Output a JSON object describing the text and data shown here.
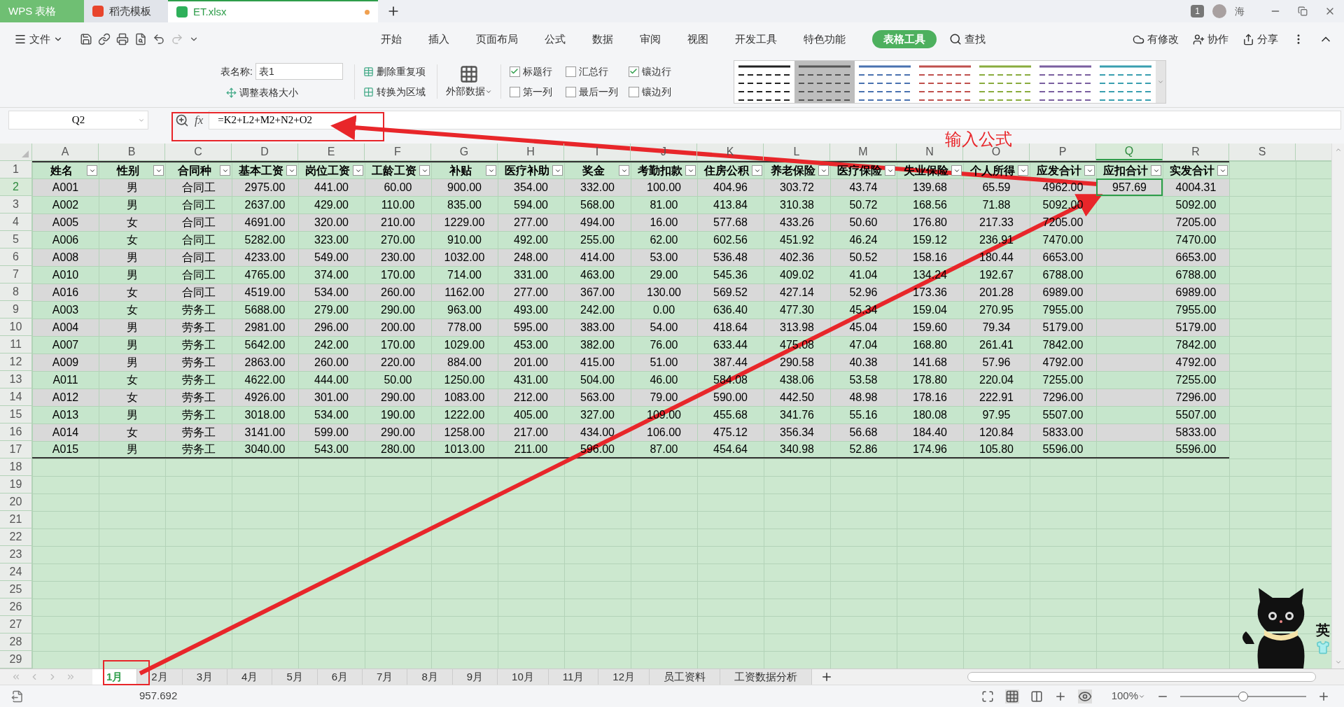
{
  "app_tabs": [
    {
      "label": "WPS 表格",
      "kind": "home",
      "selected": false
    },
    {
      "label": "稻壳模板",
      "kind": "template",
      "selected": false
    },
    {
      "label": "ET.xlsx",
      "kind": "sheet",
      "selected": true,
      "unsaved": true
    }
  ],
  "window": {
    "badge": "1",
    "user": "海"
  },
  "menu": {
    "file": "文件",
    "items": [
      {
        "label": "开始",
        "selected": false
      },
      {
        "label": "插入",
        "selected": false
      },
      {
        "label": "页面布局",
        "selected": false
      },
      {
        "label": "公式",
        "selected": false
      },
      {
        "label": "数据",
        "selected": false
      },
      {
        "label": "审阅",
        "selected": false
      },
      {
        "label": "视图",
        "selected": false
      },
      {
        "label": "开发工具",
        "selected": false
      },
      {
        "label": "特色功能",
        "selected": false
      },
      {
        "label": "表格工具",
        "selected": true
      }
    ],
    "search": "查找",
    "actions": [
      "有修改",
      "协作",
      "分享"
    ]
  },
  "ribbon": {
    "name_label": "表名称:",
    "name_value": "表1",
    "resize": "调整表格大小",
    "remove_duplicates": "删除重复项",
    "convert": "转换为区域",
    "external": "外部数据",
    "options": [
      {
        "label": "标题行",
        "checked": true
      },
      {
        "label": "汇总行",
        "checked": false
      },
      {
        "label": "镶边行",
        "checked": true
      },
      {
        "label": "第一列",
        "checked": false
      },
      {
        "label": "最后一列",
        "checked": false
      },
      {
        "label": "镶边列",
        "checked": false
      }
    ],
    "styles": [
      {
        "color": "#222222",
        "selected": false
      },
      {
        "color": "#555555",
        "selected": true
      },
      {
        "color": "#4a72b0",
        "selected": false
      },
      {
        "color": "#c0504d",
        "selected": false
      },
      {
        "color": "#8aac3e",
        "selected": false
      },
      {
        "color": "#7a5fa0",
        "selected": false
      },
      {
        "color": "#3a9fb0",
        "selected": false
      }
    ]
  },
  "formula_bar": {
    "cell": "Q2",
    "fx": "fx",
    "formula": "=K2+L2+M2+N2+O2"
  },
  "annotation": "输入公式",
  "columns": [
    {
      "label": "A",
      "selected": false
    },
    {
      "label": "B",
      "selected": false
    },
    {
      "label": "C",
      "selected": false
    },
    {
      "label": "D",
      "selected": false
    },
    {
      "label": "E",
      "selected": false
    },
    {
      "label": "F",
      "selected": false
    },
    {
      "label": "G",
      "selected": false
    },
    {
      "label": "H",
      "selected": false
    },
    {
      "label": "I",
      "selected": false
    },
    {
      "label": "J",
      "selected": false
    },
    {
      "label": "K",
      "selected": false
    },
    {
      "label": "L",
      "selected": false
    },
    {
      "label": "M",
      "selected": false
    },
    {
      "label": "N",
      "selected": false
    },
    {
      "label": "O",
      "selected": false
    },
    {
      "label": "P",
      "selected": false
    },
    {
      "label": "Q",
      "selected": true
    },
    {
      "label": "R",
      "selected": false
    },
    {
      "label": "S",
      "selected": false
    }
  ],
  "row_headers": [
    {
      "label": "1",
      "selected": false
    },
    {
      "label": "2",
      "selected": true
    },
    {
      "label": "3",
      "selected": false
    },
    {
      "label": "4",
      "selected": false
    },
    {
      "label": "5",
      "selected": false
    },
    {
      "label": "6",
      "selected": false
    },
    {
      "label": "7",
      "selected": false
    },
    {
      "label": "8",
      "selected": false
    },
    {
      "label": "9",
      "selected": false
    },
    {
      "label": "10",
      "selected": false
    },
    {
      "label": "11",
      "selected": false
    },
    {
      "label": "12",
      "selected": false
    },
    {
      "label": "13",
      "selected": false
    },
    {
      "label": "14",
      "selected": false
    },
    {
      "label": "15",
      "selected": false
    },
    {
      "label": "16",
      "selected": false
    },
    {
      "label": "17",
      "selected": false
    },
    {
      "label": "18",
      "selected": false
    },
    {
      "label": "19",
      "selected": false
    },
    {
      "label": "20",
      "selected": false
    },
    {
      "label": "21",
      "selected": false
    },
    {
      "label": "22",
      "selected": false
    },
    {
      "label": "23",
      "selected": false
    },
    {
      "label": "24",
      "selected": false
    },
    {
      "label": "25",
      "selected": false
    },
    {
      "label": "26",
      "selected": false
    },
    {
      "label": "27",
      "selected": false
    },
    {
      "label": "28",
      "selected": false
    },
    {
      "label": "29",
      "selected": false
    }
  ],
  "table_header": [
    "姓名",
    "性别",
    "合同种",
    "基本工资",
    "岗位工资",
    "工龄工资",
    "补贴",
    "医疗补助",
    "奖金",
    "考勤扣款",
    "住房公积",
    "养老保险",
    "医疗保险",
    "失业保险",
    "个人所得",
    "应发合计",
    "应扣合计",
    "实发合计"
  ],
  "table_rows": [
    [
      "A001",
      "男",
      "合同工",
      "2975.00",
      "441.00",
      "60.00",
      "900.00",
      "354.00",
      "332.00",
      "100.00",
      "404.96",
      "303.72",
      "43.74",
      "139.68",
      "65.59",
      "4962.00",
      "957.69",
      "4004.31"
    ],
    [
      "A002",
      "男",
      "合同工",
      "2637.00",
      "429.00",
      "110.00",
      "835.00",
      "594.00",
      "568.00",
      "81.00",
      "413.84",
      "310.38",
      "50.72",
      "168.56",
      "71.88",
      "5092.00",
      null,
      "5092.00"
    ],
    [
      "A005",
      "女",
      "合同工",
      "4691.00",
      "320.00",
      "210.00",
      "1229.00",
      "277.00",
      "494.00",
      "16.00",
      "577.68",
      "433.26",
      "50.60",
      "176.80",
      "217.33",
      "7205.00",
      null,
      "7205.00"
    ],
    [
      "A006",
      "女",
      "合同工",
      "5282.00",
      "323.00",
      "270.00",
      "910.00",
      "492.00",
      "255.00",
      "62.00",
      "602.56",
      "451.92",
      "46.24",
      "159.12",
      "236.91",
      "7470.00",
      null,
      "7470.00"
    ],
    [
      "A008",
      "男",
      "合同工",
      "4233.00",
      "549.00",
      "230.00",
      "1032.00",
      "248.00",
      "414.00",
      "53.00",
      "536.48",
      "402.36",
      "50.52",
      "158.16",
      "180.44",
      "6653.00",
      null,
      "6653.00"
    ],
    [
      "A010",
      "男",
      "合同工",
      "4765.00",
      "374.00",
      "170.00",
      "714.00",
      "331.00",
      "463.00",
      "29.00",
      "545.36",
      "409.02",
      "41.04",
      "134.24",
      "192.67",
      "6788.00",
      null,
      "6788.00"
    ],
    [
      "A016",
      "女",
      "合同工",
      "4519.00",
      "534.00",
      "260.00",
      "1162.00",
      "277.00",
      "367.00",
      "130.00",
      "569.52",
      "427.14",
      "52.96",
      "173.36",
      "201.28",
      "6989.00",
      null,
      "6989.00"
    ],
    [
      "A003",
      "女",
      "劳务工",
      "5688.00",
      "279.00",
      "290.00",
      "963.00",
      "493.00",
      "242.00",
      "0.00",
      "636.40",
      "477.30",
      "45.34",
      "159.04",
      "270.95",
      "7955.00",
      null,
      "7955.00"
    ],
    [
      "A004",
      "男",
      "劳务工",
      "2981.00",
      "296.00",
      "200.00",
      "778.00",
      "595.00",
      "383.00",
      "54.00",
      "418.64",
      "313.98",
      "45.04",
      "159.60",
      "79.34",
      "5179.00",
      null,
      "5179.00"
    ],
    [
      "A007",
      "男",
      "劳务工",
      "5642.00",
      "242.00",
      "170.00",
      "1029.00",
      "453.00",
      "382.00",
      "76.00",
      "633.44",
      "475.08",
      "47.04",
      "168.80",
      "261.41",
      "7842.00",
      null,
      "7842.00"
    ],
    [
      "A009",
      "男",
      "劳务工",
      "2863.00",
      "260.00",
      "220.00",
      "884.00",
      "201.00",
      "415.00",
      "51.00",
      "387.44",
      "290.58",
      "40.38",
      "141.68",
      "57.96",
      "4792.00",
      null,
      "4792.00"
    ],
    [
      "A011",
      "女",
      "劳务工",
      "4622.00",
      "444.00",
      "50.00",
      "1250.00",
      "431.00",
      "504.00",
      "46.00",
      "584.08",
      "438.06",
      "53.58",
      "178.80",
      "220.04",
      "7255.00",
      null,
      "7255.00"
    ],
    [
      "A012",
      "女",
      "劳务工",
      "4926.00",
      "301.00",
      "290.00",
      "1083.00",
      "212.00",
      "563.00",
      "79.00",
      "590.00",
      "442.50",
      "48.98",
      "178.16",
      "222.91",
      "7296.00",
      null,
      "7296.00"
    ],
    [
      "A013",
      "男",
      "劳务工",
      "3018.00",
      "534.00",
      "190.00",
      "1222.00",
      "405.00",
      "327.00",
      "109.00",
      "455.68",
      "341.76",
      "55.16",
      "180.08",
      "97.95",
      "5507.00",
      null,
      "5507.00"
    ],
    [
      "A014",
      "女",
      "劳务工",
      "3141.00",
      "599.00",
      "290.00",
      "1258.00",
      "217.00",
      "434.00",
      "106.00",
      "475.12",
      "356.34",
      "56.68",
      "184.40",
      "120.84",
      "5833.00",
      null,
      "5833.00"
    ],
    [
      "A015",
      "男",
      "劳务工",
      "3040.00",
      "543.00",
      "280.00",
      "1013.00",
      "211.00",
      "596.00",
      "87.00",
      "454.64",
      "340.98",
      "52.86",
      "174.96",
      "105.80",
      "5596.00",
      null,
      "5596.00"
    ]
  ],
  "sheet_tabs": [
    {
      "label": "1月",
      "selected": true
    },
    {
      "label": "2月",
      "selected": false
    },
    {
      "label": "3月",
      "selected": false
    },
    {
      "label": "4月",
      "selected": false
    },
    {
      "label": "5月",
      "selected": false
    },
    {
      "label": "6月",
      "selected": false
    },
    {
      "label": "7月",
      "selected": false
    },
    {
      "label": "8月",
      "selected": false
    },
    {
      "label": "9月",
      "selected": false
    },
    {
      "label": "10月",
      "selected": false
    },
    {
      "label": "11月",
      "selected": false
    },
    {
      "label": "12月",
      "selected": false
    },
    {
      "label": "员工资料",
      "selected": false
    },
    {
      "label": "工资数据分析",
      "selected": false
    }
  ],
  "status_bar": {
    "value": "957.692",
    "zoom": "100%",
    "zoom_level": {
      "level": 0.5
    }
  },
  "ime": {
    "label": "英"
  }
}
